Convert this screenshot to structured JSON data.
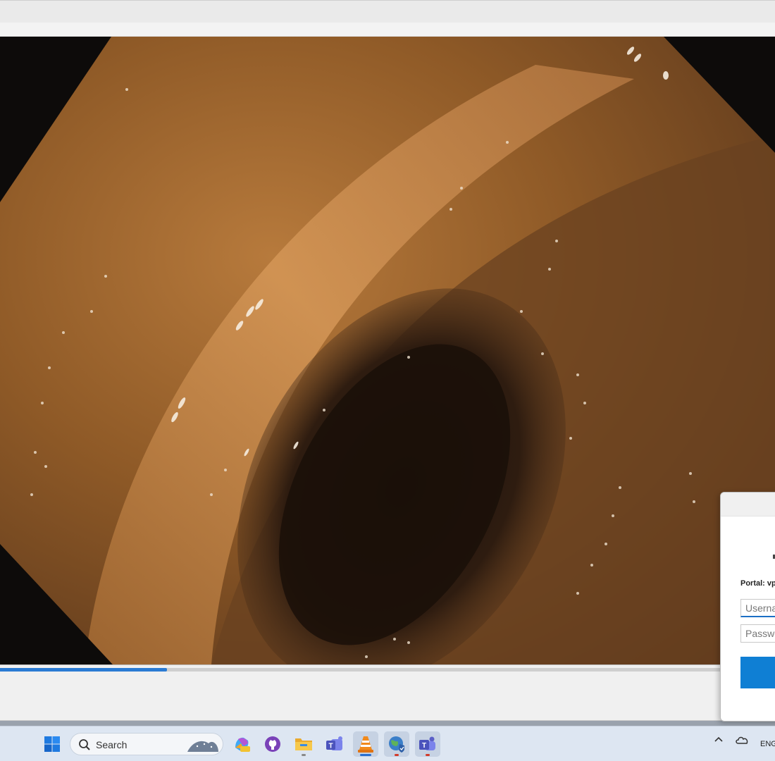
{
  "dialog": {
    "portal_label": "Portal: vp",
    "username_placeholder": "Userna",
    "password_placeholder": "Passwo"
  },
  "player": {
    "progress": 0.215
  },
  "taskbar": {
    "search_label": "Search",
    "language": "ENG",
    "apps": [
      {
        "name": "start-button"
      },
      {
        "name": "copilot-pre-app"
      },
      {
        "name": "github-desktop-app"
      },
      {
        "name": "file-explorer-app"
      },
      {
        "name": "teams-classic-app"
      },
      {
        "name": "vlc-player-app"
      },
      {
        "name": "vpn-globe-app"
      },
      {
        "name": "teams-app"
      }
    ]
  },
  "colors": {
    "accent": "#0f7fd4",
    "seek_fill": "#2a7bd3",
    "taskbar": "#dde6f2"
  }
}
